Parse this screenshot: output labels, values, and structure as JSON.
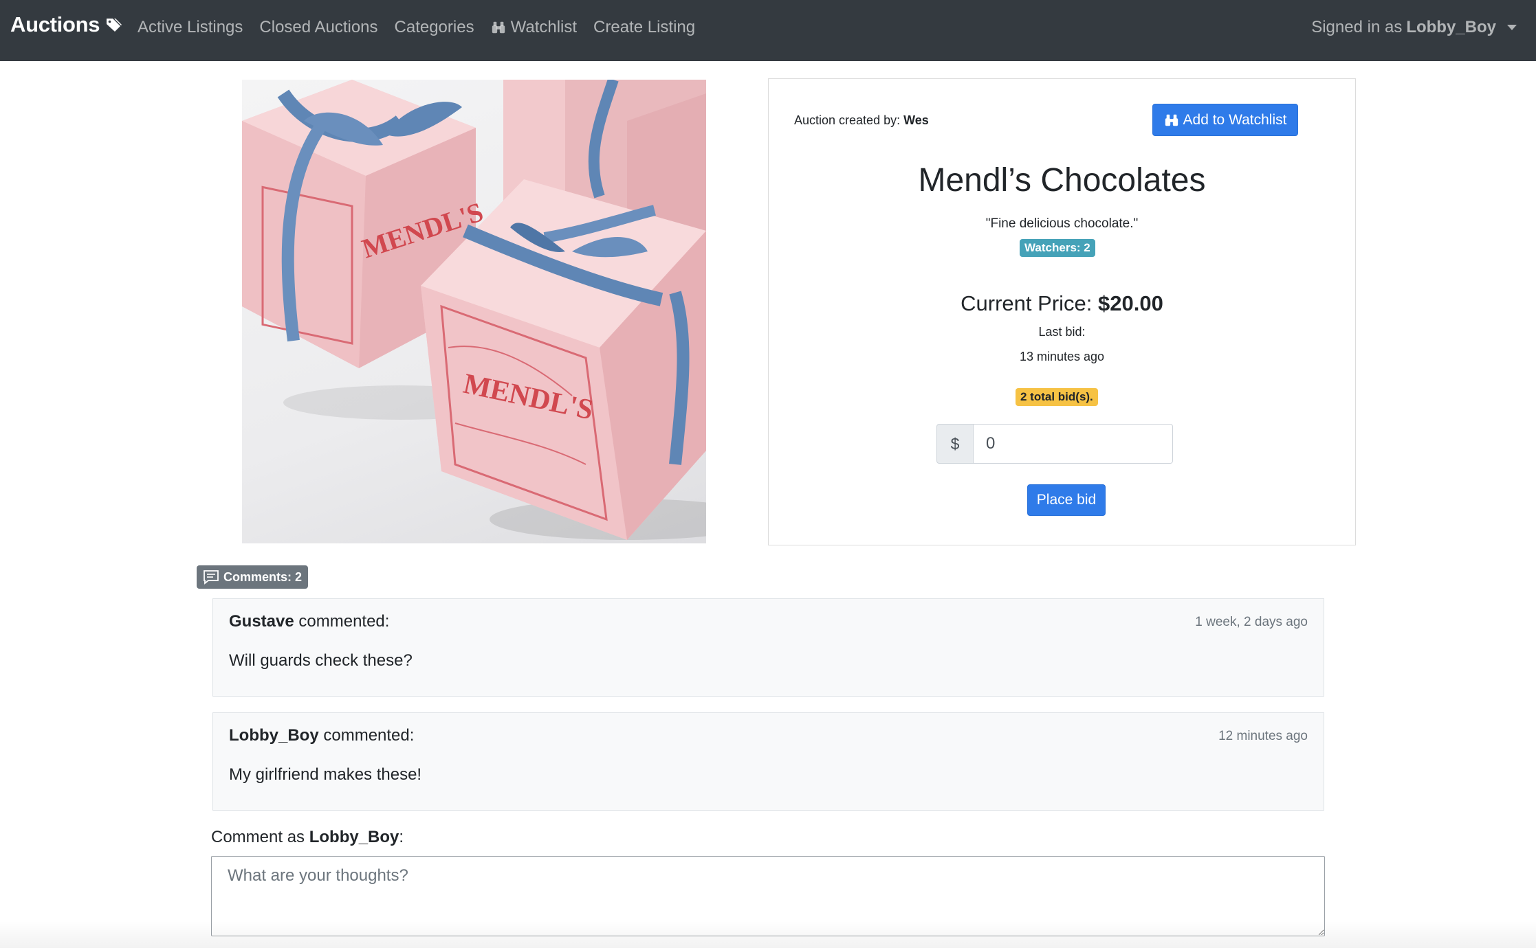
{
  "navbar": {
    "brand": "Auctions",
    "brand_icon": "tags-icon",
    "links": [
      {
        "label": "Active Listings"
      },
      {
        "label": "Closed Auctions"
      },
      {
        "label": "Categories"
      },
      {
        "label": "Watchlist",
        "icon": "binoculars-icon"
      },
      {
        "label": "Create Listing"
      }
    ],
    "signed_in_prefix": "Signed in as",
    "username": "Lobby_Boy"
  },
  "listing": {
    "image_subject": "pink Mendl's pastry boxes tied with blue ribbons",
    "box_brand_text": "MENDL'S",
    "created_by_label": "Auction created by:",
    "created_by": "Wes",
    "watchlist_button": "Add to Watchlist",
    "title": "Mendl’s Chocolates",
    "description": "\"Fine delicious chocolate.\"",
    "watchers_badge": "Watchers: 2",
    "price_label": "Current Price:",
    "price_value": "$20.00",
    "last_bid_label": "Last bid:",
    "last_bid_time": "13 minutes ago",
    "total_bids_badge": "2 total bid(s).",
    "bid_prefix": "$",
    "bid_value": "0",
    "place_bid_button": "Place bid"
  },
  "comments": {
    "badge": "Comments: 2",
    "items": [
      {
        "author": "Gustave",
        "suffix": "commented:",
        "time": "1 week, 2 days ago",
        "text": "Will guards check these?"
      },
      {
        "author": "Lobby_Boy",
        "suffix": "commented:",
        "time": "12 minutes ago",
        "text": "My girlfriend makes these!"
      }
    ],
    "form_prefix": "Comment as",
    "form_user": "Lobby_Boy",
    "form_suffix": ":",
    "placeholder": "What are your thoughts?"
  },
  "colors": {
    "navbar_bg": "#343a40",
    "primary": "#2f7be9",
    "info_badge": "#45a2b8",
    "warning_badge": "#f6c244",
    "secondary_badge": "#6c757d"
  }
}
